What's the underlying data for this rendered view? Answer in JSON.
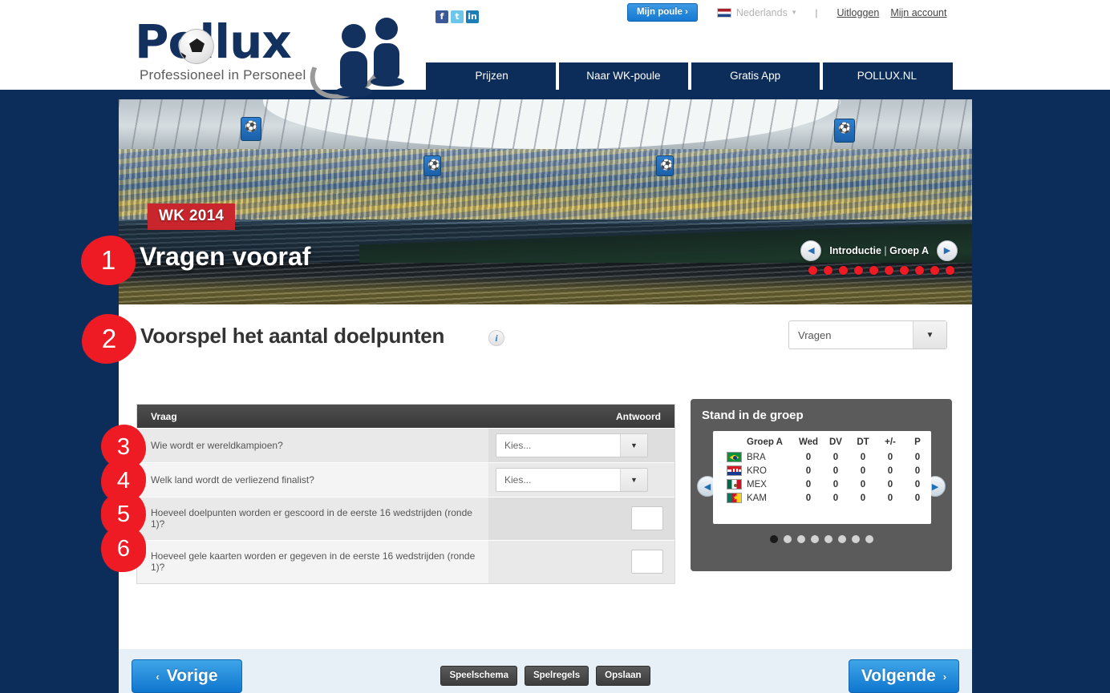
{
  "header": {
    "logo_word": "Pollux",
    "logo_tagline": "Professioneel in Personeel",
    "socials": [
      {
        "name": "facebook",
        "glyph": "f"
      },
      {
        "name": "twitter",
        "glyph": "t"
      },
      {
        "name": "linkedin",
        "glyph": "in"
      }
    ],
    "mijn_poule_label": "Mijn poule ›",
    "language": "Nederlands",
    "separator": "|",
    "logout_label": "Uitloggen",
    "account_label": "Mijn account",
    "nav": [
      {
        "label": "Prijzen"
      },
      {
        "label": "Naar WK-poule"
      },
      {
        "label": "Gratis App"
      },
      {
        "label": "POLLUX.NL"
      }
    ]
  },
  "hero": {
    "badge": "WK 2014",
    "title": "Vragen vooraf",
    "pager_prev_icon": "◀",
    "pager_next_icon": "▶",
    "pager_current": "Introductie",
    "pager_divider": "|",
    "pager_next_label": "Groep A",
    "dot_count": 10
  },
  "section2": {
    "number": "2",
    "title": "Voorspel het aantal doelpunten",
    "info_icon_label": "i",
    "select_value": "Vragen",
    "select_caret": "▼"
  },
  "section1": {
    "number": "1"
  },
  "questions_table": {
    "col_question": "Vraag",
    "col_answer": "Antwoord",
    "rows": [
      {
        "number": "3",
        "question": "Wie wordt er wereldkampioen?",
        "answer_type": "select",
        "answer_value": "Kies...",
        "caret": "▼"
      },
      {
        "number": "4",
        "question": "Welk land wordt de verliezend finalist?",
        "answer_type": "select",
        "answer_value": "Kies...",
        "caret": "▼"
      },
      {
        "number": "5",
        "question": "Hoeveel doelpunten worden er gescoord in de eerste 16 wedstrijden (ronde 1)?",
        "answer_type": "number",
        "answer_value": ""
      },
      {
        "number": "6",
        "question": "Hoeveel gele kaarten worden er gegeven in de eerste 16 wedstrijden (ronde 1)?",
        "answer_type": "number",
        "answer_value": ""
      }
    ]
  },
  "standings": {
    "title": "Stand in de groep",
    "prev_icon": "◀",
    "next_icon": "▶",
    "columns": [
      "Groep A",
      "Wed",
      "DV",
      "DT",
      "+/-",
      "P"
    ],
    "rows": [
      {
        "flag": "brazil-flag",
        "team": "BRA",
        "wed": "0",
        "dv": "0",
        "dt": "0",
        "gd": "0",
        "p": "0"
      },
      {
        "flag": "croatia-flag",
        "team": "KRO",
        "wed": "0",
        "dv": "0",
        "dt": "0",
        "gd": "0",
        "p": "0"
      },
      {
        "flag": "mexico-flag",
        "team": "MEX",
        "wed": "0",
        "dv": "0",
        "dt": "0",
        "gd": "0",
        "p": "0"
      },
      {
        "flag": "cameroon-flag",
        "team": "KAM",
        "wed": "0",
        "dv": "0",
        "dt": "0",
        "gd": "0",
        "p": "0"
      }
    ],
    "dot_count": 8,
    "active_dot": 0
  },
  "footer": {
    "prev_label": "Vorige",
    "prev_chev": "‹",
    "next_label": "Volgende",
    "next_chev": "›",
    "mid_buttons": [
      {
        "label": "Speelschema"
      },
      {
        "label": "Spelregels"
      },
      {
        "label": "Opslaan"
      }
    ]
  },
  "colors": {
    "navy": "#0c2d59",
    "accent_blue": "#1679d2",
    "annotation_red": "#ee1b24",
    "badge_red": "#c8252c",
    "panel_grey": "#5b5b5b"
  }
}
